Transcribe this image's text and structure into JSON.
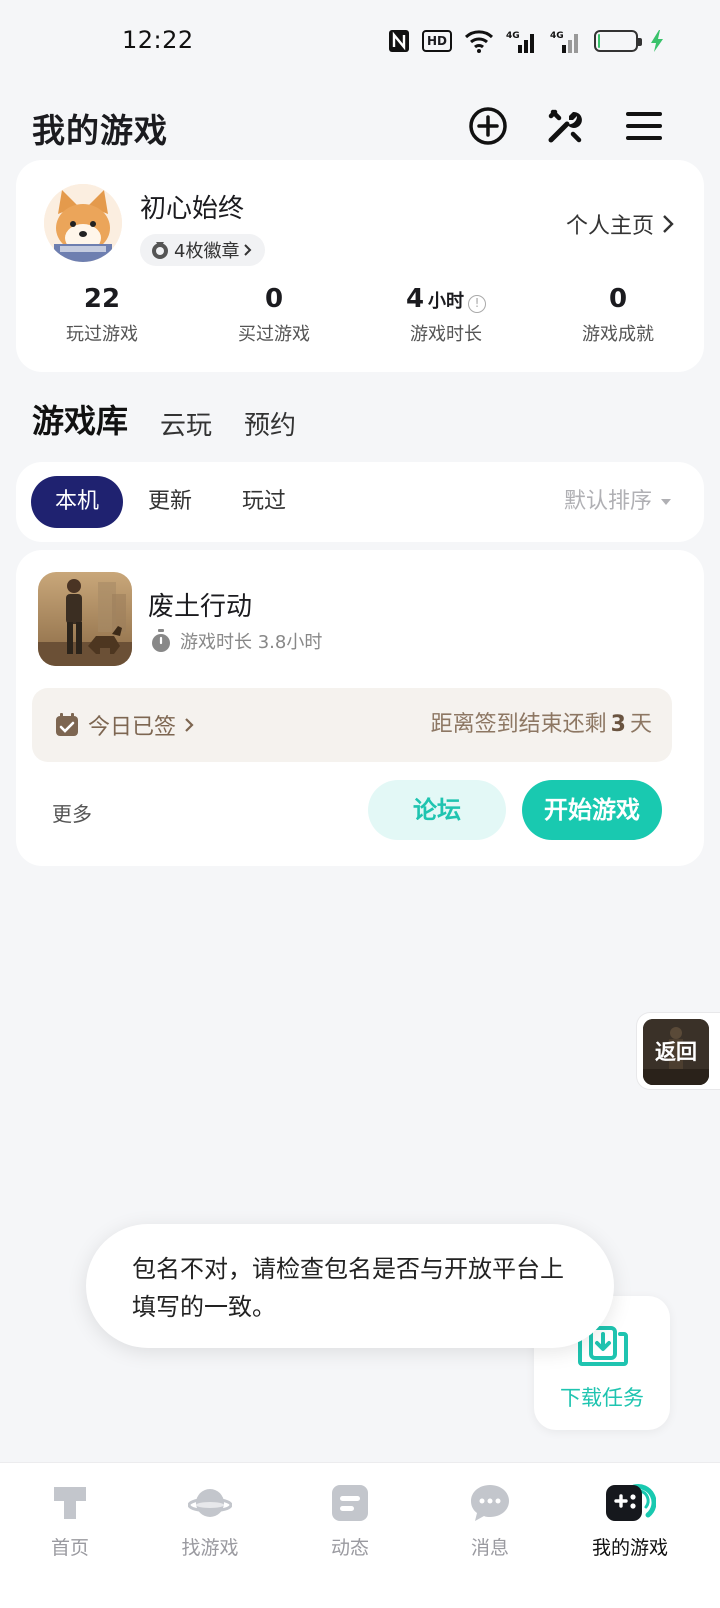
{
  "status_bar": {
    "time": "12:22",
    "hd_label": "HD",
    "net1": "4G",
    "net2": "4G",
    "battery_level": 0.05,
    "charging_color": "#39c26b"
  },
  "header": {
    "title": "我的游戏",
    "icons": [
      "add-circle-icon",
      "tools-icon",
      "menu-icon"
    ]
  },
  "profile": {
    "username": "初心始终",
    "badges": "4枚徽章",
    "homepage": "个人主页",
    "stats": [
      {
        "value": "22",
        "unit": "",
        "label": "玩过游戏"
      },
      {
        "value": "0",
        "unit": "",
        "label": "买过游戏"
      },
      {
        "value": "4",
        "unit": "小时",
        "label": "游戏时长"
      },
      {
        "value": "0",
        "unit": "",
        "label": "游戏成就"
      }
    ]
  },
  "section_tabs": [
    "游戏库",
    "云玩",
    "预约"
  ],
  "filter": {
    "chips": [
      "本机",
      "更新",
      "玩过"
    ],
    "sort": "默认排序"
  },
  "game": {
    "name": "废土行动",
    "playtime": "游戏时长 3.8小时",
    "checkin": "今日已签",
    "checkin_remaining_prefix": "距离签到结束还剩",
    "checkin_days": "3",
    "checkin_suffix": "天",
    "more": "更多",
    "forum": "论坛",
    "start": "开始游戏"
  },
  "float_back": "返回",
  "download_task": "下载任务",
  "toast": "包名不对，请检查包名是否与开放平台上填写的一致。",
  "bottom_nav": [
    {
      "label": "首页",
      "icon": "home-icon"
    },
    {
      "label": "找游戏",
      "icon": "planet-icon"
    },
    {
      "label": "动态",
      "icon": "feed-icon"
    },
    {
      "label": "消息",
      "icon": "message-icon"
    },
    {
      "label": "我的游戏",
      "icon": "gamepad-icon"
    }
  ],
  "colors": {
    "accent": "#19c9b0",
    "chip_active": "#1f2270",
    "checkin_bg": "#f5f2ee"
  }
}
